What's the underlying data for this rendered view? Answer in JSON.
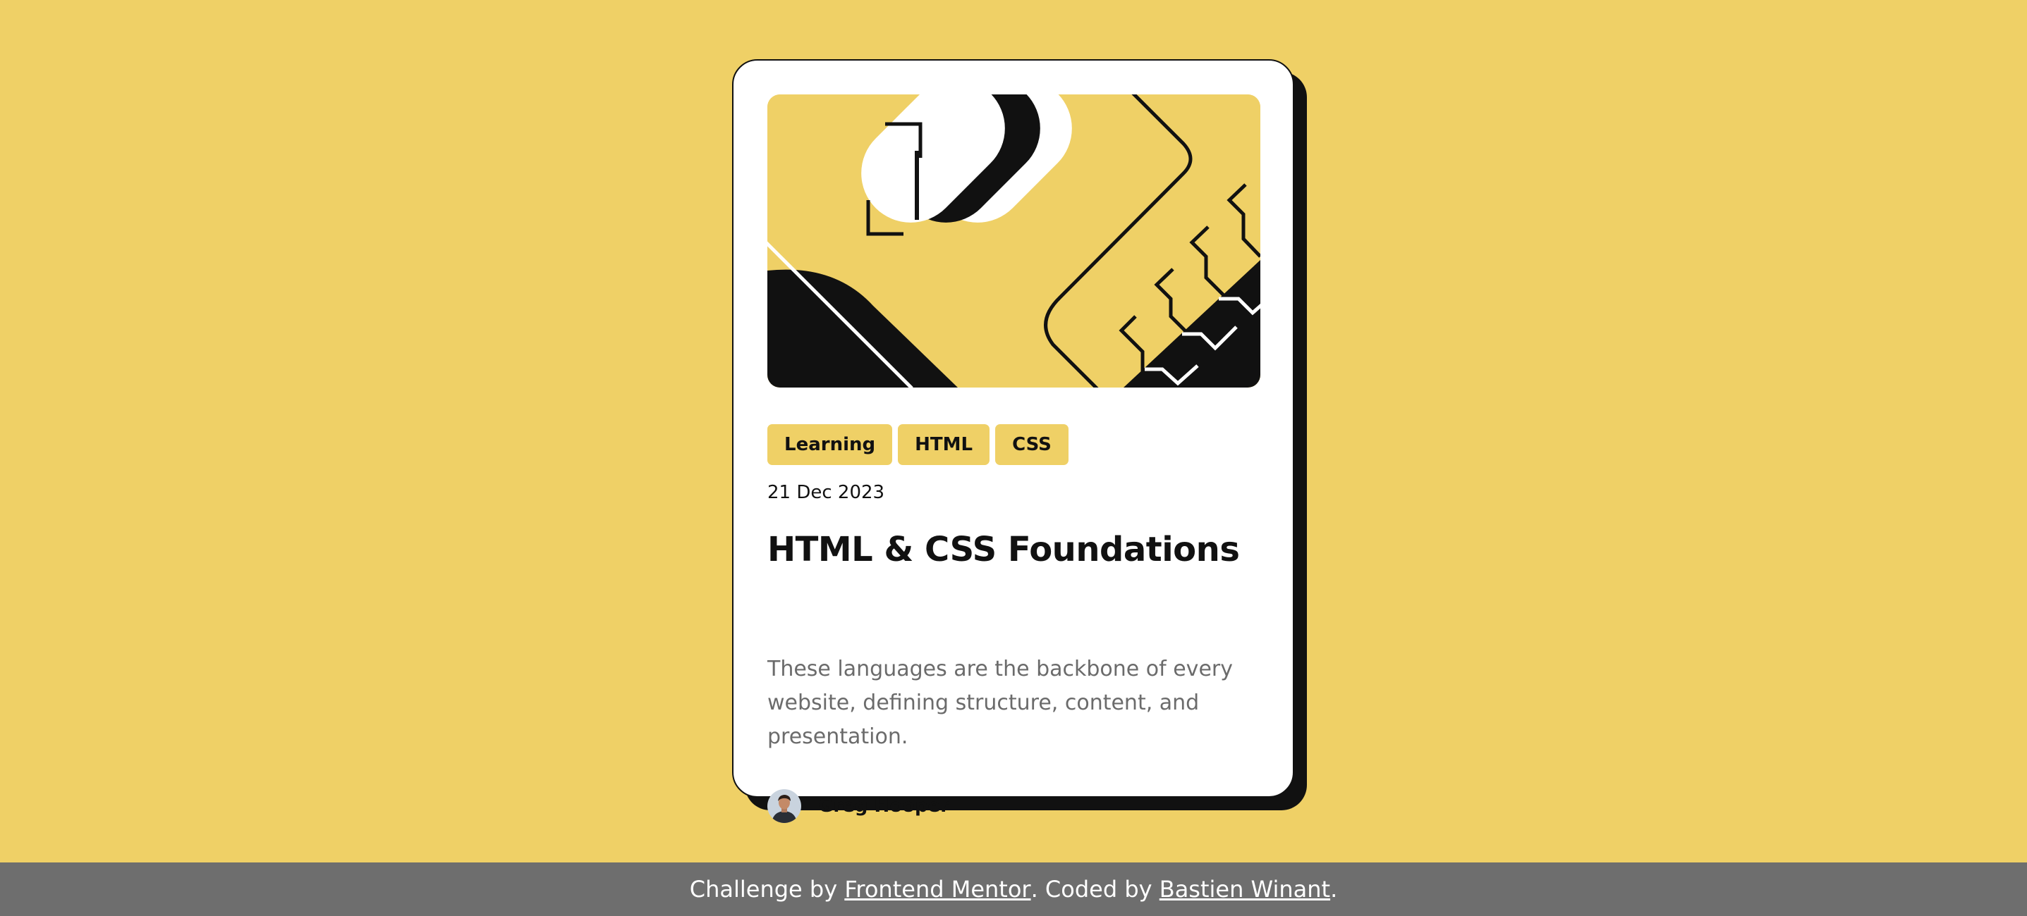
{
  "colors": {
    "background": "#EFD066",
    "card": "#FFFFFF",
    "ink": "#111111",
    "body_text": "#6B6B6B",
    "footer": "#6E6E6E"
  },
  "card": {
    "tags": [
      "Learning",
      "HTML",
      "CSS"
    ],
    "date": "21 Dec 2023",
    "title": "HTML & CSS Foundations",
    "description": "These languages are the backbone of every website, defining structure, content, and presentation.",
    "author": {
      "name": "Greg Hooper",
      "avatar_icon": "person-avatar"
    },
    "illustration_icon": "code-brackets-illustration"
  },
  "footer": {
    "prefix": "Challenge by ",
    "link1": "Frontend Mentor",
    "middle": ". Coded by ",
    "link2": "Bastien Winant",
    "suffix": "."
  }
}
